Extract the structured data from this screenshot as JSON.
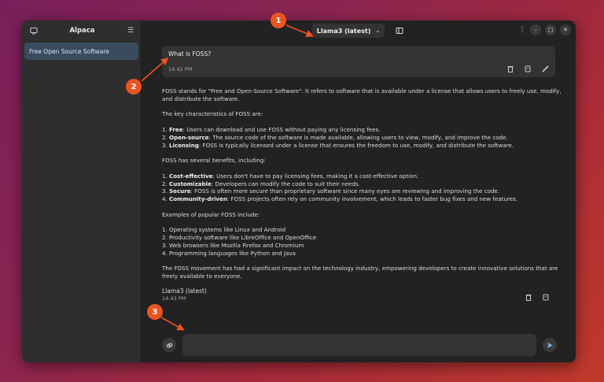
{
  "sidebar": {
    "title": "Alpaca",
    "items": [
      {
        "label": "Free Open Source Software"
      }
    ]
  },
  "header": {
    "model_label": "Llama3 (latest)"
  },
  "user_message": {
    "text": "What is FOSS?",
    "time": "14:42 PM"
  },
  "response": {
    "intro": "FOSS stands for \"Free and Open-Source Software\". It refers to software that is available under a license that allows users to freely use, modify, and distribute the software.",
    "characteristics_heading": "The key characteristics of FOSS are:",
    "characteristics": [
      {
        "num": "1. ",
        "term": "Free",
        "desc": ": Users can download and use FOSS without paying any licensing fees."
      },
      {
        "num": "2. ",
        "term": "Open-source",
        "desc": ": The source code of the software is made available, allowing users to view, modify, and improve the code."
      },
      {
        "num": "3. ",
        "term": "Licensing",
        "desc": ": FOSS is typically licensed under a license that ensures the freedom to use, modify, and distribute the software."
      }
    ],
    "benefits_heading": "FOSS has several benefits, including:",
    "benefits": [
      {
        "num": "1. ",
        "term": "Cost-effective",
        "desc": ": Users don't have to pay licensing fees, making it a cost-effective option."
      },
      {
        "num": "2. ",
        "term": "Customizable",
        "desc": ": Developers can modify the code to suit their needs."
      },
      {
        "num": "3. ",
        "term": "Secure",
        "desc": ": FOSS is often more secure than proprietary software since many eyes are reviewing and improving the code."
      },
      {
        "num": "4. ",
        "term": "Community-driven",
        "desc": ": FOSS projects often rely on community involvement, which leads to faster bug fixes and new features."
      }
    ],
    "examples_heading": "Examples of popular FOSS include:",
    "examples": [
      "1. Operating systems like Linux and Android",
      "2. Productivity software like LibreOffice and OpenOffice",
      "3. Web browsers like Mozilla Firefox and Chromium",
      "4. Programming languages like Python and Java"
    ],
    "conclusion": "The FOSS movement has had a significant impact on the technology industry, empowering developers to create innovative solutions that are freely available to everyone.",
    "model": "Llama3 (latest)",
    "time": "14:43 PM"
  },
  "input": {
    "value": "",
    "placeholder": ""
  },
  "callouts": [
    "1",
    "2",
    "3"
  ],
  "colors": {
    "callout": "#e95420",
    "selected_item": "#3a4b5e",
    "window_bg": "#242424"
  }
}
